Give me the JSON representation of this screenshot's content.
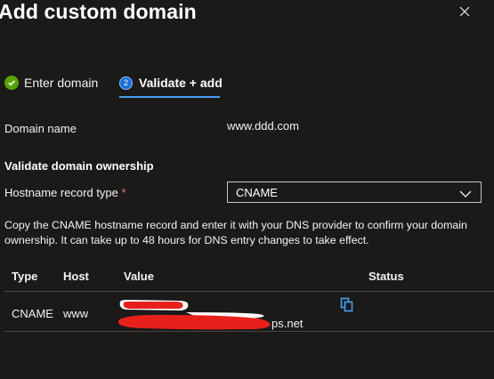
{
  "dialog": {
    "title": "Add custom domain",
    "close_icon": "close-icon"
  },
  "steps": [
    {
      "label": "Enter domain",
      "state": "completed",
      "icon": "check-circle-icon"
    },
    {
      "label": "Validate + add",
      "number": "2",
      "state": "active"
    }
  ],
  "form": {
    "domain_label": "Domain name",
    "domain_value": "www.ddd.com",
    "section_heading": "Validate domain ownership",
    "hostname_label": "Hostname record type",
    "required_marker": "*",
    "hostname_selected": "CNAME",
    "info_text": "Copy the CNAME hostname record and enter it with your DNS provider to confirm your domain ownership. It can take up to 48 hours for DNS entry changes to take effect."
  },
  "table": {
    "columns": [
      "Type",
      "Host",
      "Value",
      "Status"
    ],
    "rows": [
      {
        "type": "CNAME",
        "host": "www",
        "value_visible": "ps.net",
        "value_redacted": true,
        "status": ""
      }
    ]
  },
  "colors": {
    "background": "#1b1a19",
    "accent": "#479ef5",
    "success": "#57a300",
    "required": "#f1707b",
    "redaction": "#e8201c"
  }
}
